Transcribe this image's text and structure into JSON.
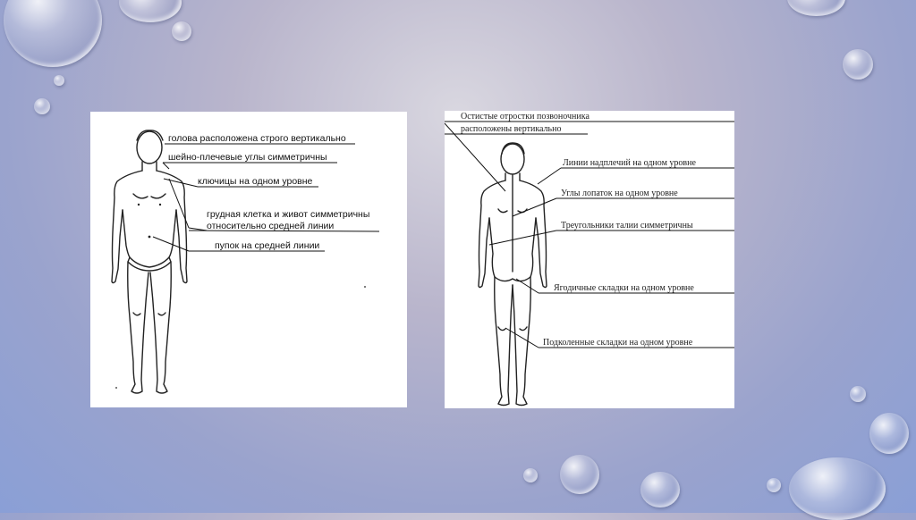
{
  "front_view": {
    "labels": [
      "голова расположена строго вертикально",
      "шейно-плечевые углы симметричны",
      "ключицы на одном уровне",
      "грудная клетка и живот симметричны",
      "относительно средней линии",
      "пупок на средней линии"
    ]
  },
  "back_view": {
    "labels": [
      "Остистые отростки позвоночника",
      "расположены вертикально",
      "Линии надплечий на одном уровне",
      "Углы лопаток на одном уровне",
      "Треугольники талии симметричны",
      "Ягодичные складки на одном уровне",
      "Подколенные складки на одном уровне"
    ]
  }
}
